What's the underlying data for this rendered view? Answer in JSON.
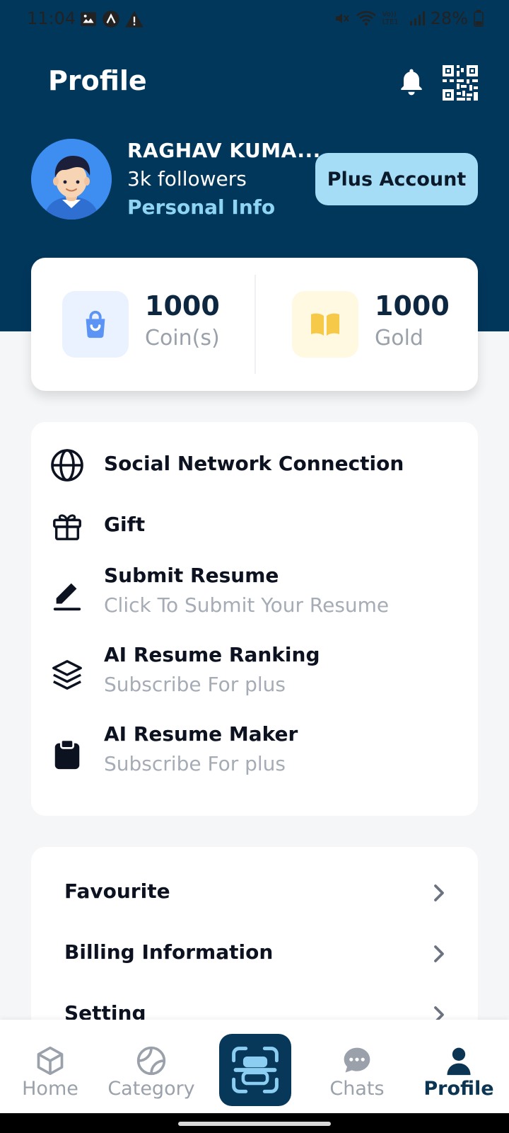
{
  "status_bar": {
    "time": "11:04",
    "battery": "28%",
    "network": "Vo)) LTE1"
  },
  "header": {
    "title": "Profile",
    "bell_icon": "bell-icon",
    "qr_icon": "qr-code-icon",
    "background_color": "#02375c"
  },
  "user": {
    "name": "RAGHAV KUMA...",
    "followers": "3k followers",
    "personal_info_link": "Personal Info",
    "plus_button": "Plus Account"
  },
  "wallet": {
    "coins": {
      "amount": "1000",
      "label": "Coin(s)",
      "icon": "shopping-bag-icon"
    },
    "gold": {
      "amount": "1000",
      "label": "Gold",
      "icon": "book-icon"
    }
  },
  "menu": {
    "items": [
      {
        "title": "Social Network Connection",
        "subtitle": "",
        "icon": "globe-icon"
      },
      {
        "title": "Gift",
        "subtitle": "",
        "icon": "gift-icon"
      },
      {
        "title": "Submit Resume",
        "subtitle": "Click To Submit Your Resume",
        "icon": "pen-icon"
      },
      {
        "title": "AI Resume Ranking",
        "subtitle": "Subscribe For plus",
        "icon": "layers-icon"
      },
      {
        "title": "AI Resume Maker",
        "subtitle": "Subscribe For plus",
        "icon": "clipboard-icon"
      }
    ]
  },
  "settings_list": {
    "items": [
      {
        "label": "Favourite"
      },
      {
        "label": "Billing Information"
      },
      {
        "label": "Setting"
      }
    ]
  },
  "bottom_nav": {
    "items": [
      {
        "label": "Home",
        "icon": "cube-icon"
      },
      {
        "label": "Category",
        "icon": "basketball-icon"
      },
      {
        "label": "",
        "icon": "scan-icon"
      },
      {
        "label": "Chats",
        "icon": "chat-bubble-icon"
      },
      {
        "label": "Profile",
        "icon": "person-icon",
        "active": true
      }
    ]
  }
}
